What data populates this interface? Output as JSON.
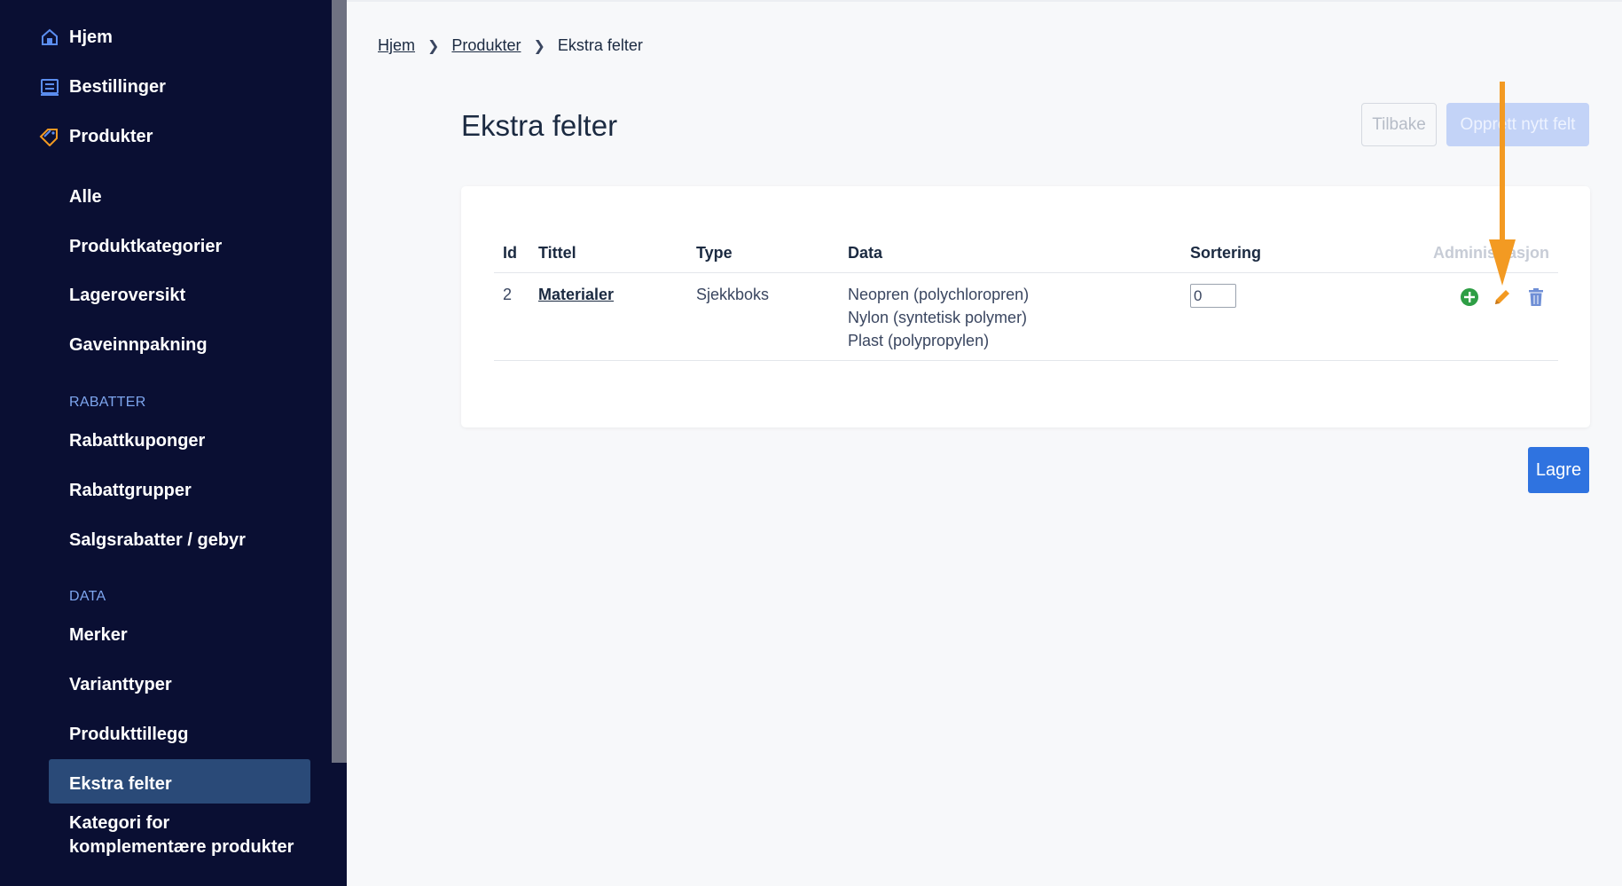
{
  "sidebar": {
    "top_items": [
      {
        "label": "Hjem",
        "icon": "home-icon"
      },
      {
        "label": "Bestillinger",
        "icon": "orders-icon"
      },
      {
        "label": "Produkter",
        "icon": "tag-icon"
      }
    ],
    "product_items": [
      "Alle",
      "Produktkategorier",
      "Lageroversikt",
      "Gaveinnpakning"
    ],
    "section_rabatter": "RABATTER",
    "rabatter_items": [
      "Rabattkuponger",
      "Rabattgrupper",
      "Salgsrabatter / gebyr"
    ],
    "section_data": "DATA",
    "data_items": [
      "Merker",
      "Varianttyper",
      "Produkttillegg",
      "Ekstra felter"
    ],
    "last_item_line1": "Kategori for",
    "last_item_line2": "komplementære produkter",
    "active": "Ekstra felter"
  },
  "breadcrumb": {
    "home": "Hjem",
    "products": "Produkter",
    "current": "Ekstra felter"
  },
  "page": {
    "title": "Ekstra felter",
    "back_button": "Tilbake",
    "new_button": "Opprett nytt felt",
    "save_button": "Lagre"
  },
  "table": {
    "headers": {
      "id": "Id",
      "title": "Tittel",
      "type": "Type",
      "data": "Data",
      "sort": "Sortering",
      "admin": "Administrasjon"
    },
    "rows": [
      {
        "id": "2",
        "title": "Materialer",
        "type": "Sjekkboks",
        "data": [
          "Neopren (polychloropren)",
          "Nylon (syntetisk polymer)",
          "Plast (polypropylen)"
        ],
        "sort": "0"
      }
    ]
  },
  "colors": {
    "sidebar_bg": "#0a0f33",
    "sidebar_active": "#2a4a78",
    "primary": "#2f73e0",
    "add_icon": "#2e9e45",
    "edit_icon": "#f39a22",
    "delete_icon": "#6f8fd6",
    "annotation_arrow": "#f39a22"
  }
}
